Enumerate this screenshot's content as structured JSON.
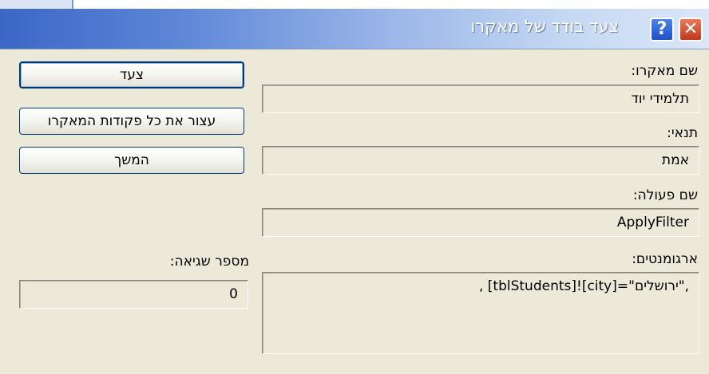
{
  "window": {
    "title": "צעד בודד של מאקרו",
    "help_glyph": "?",
    "close_glyph": "✕"
  },
  "fields": {
    "macro_name_label": "שם מאקרו:",
    "macro_name_value": "תלמידי יוד",
    "condition_label": "תנאי:",
    "condition_value": "אמת",
    "action_name_label": "שם פעולה:",
    "action_name_value": "ApplyFilter",
    "arguments_label": "ארגומנטים:",
    "arguments_value": ", [tblStudents]![city]=\"ירושלים\",",
    "error_number_label": "מספר שגיאה:",
    "error_number_value": "0"
  },
  "buttons": {
    "step_label": "צעד",
    "stop_all_label": "עצור את כל פקודות המאקרו",
    "continue_label": "המשך"
  },
  "colors": {
    "dialog_bg": "#ece9d8",
    "title_gradient_start": "#3b66c6",
    "close_button": "#c0391a",
    "help_button": "#1f52c8"
  }
}
